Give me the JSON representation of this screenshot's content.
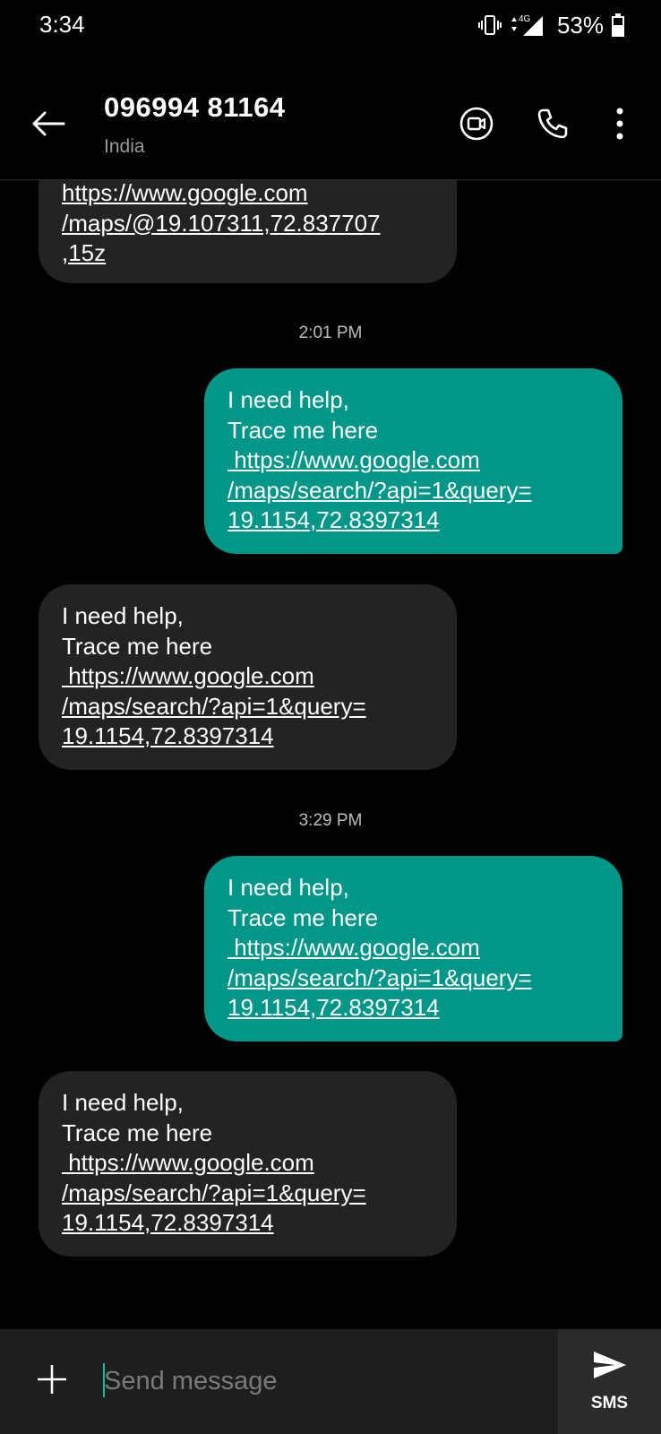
{
  "status_bar": {
    "time": "3:34",
    "network": "4G",
    "battery": "53%"
  },
  "header": {
    "contact_name": "096994 81164",
    "contact_subtitle": "India",
    "icons": {
      "back": "arrow-left-icon",
      "video": "video-call-icon",
      "call": "phone-icon",
      "more": "more-vert-icon"
    }
  },
  "thread": {
    "partial_message": {
      "direction": "incoming",
      "lines": [
        "https://www.google.com",
        "/maps/@19.107311,72.837707",
        ",15z"
      ]
    },
    "groups": [
      {
        "timestamp": "2:01 PM",
        "messages": [
          {
            "direction": "outgoing",
            "lines": [
              "I need help,",
              "Trace me here"
            ],
            "link_lines": [
              " https://www.google.com",
              "/maps/search/?api=1&query=",
              "19.1154,72.8397314"
            ]
          },
          {
            "direction": "incoming",
            "lines": [
              "I need help,",
              "Trace me here"
            ],
            "link_lines": [
              " https://www.google.com",
              "/maps/search/?api=1&query=",
              "19.1154,72.8397314"
            ]
          }
        ]
      },
      {
        "timestamp": "3:29 PM",
        "messages": [
          {
            "direction": "outgoing",
            "lines": [
              "I need help,",
              "Trace me here"
            ],
            "link_lines": [
              " https://www.google.com",
              "/maps/search/?api=1&query=",
              "19.1154,72.8397314"
            ]
          },
          {
            "direction": "incoming",
            "lines": [
              "I need help,",
              "Trace me here"
            ],
            "link_lines": [
              " https://www.google.com",
              "/maps/search/?api=1&query=",
              "19.1154,72.8397314"
            ]
          }
        ]
      }
    ]
  },
  "compose": {
    "placeholder": "Send message",
    "value": "",
    "send_label": "SMS",
    "icons": {
      "add": "plus-icon",
      "send": "send-icon"
    }
  },
  "colors": {
    "background": "#000000",
    "incoming_bubble": "#232323",
    "outgoing_bubble": "#009688",
    "compose_bar": "#1e1e1e",
    "accent": "#00bfa5"
  }
}
